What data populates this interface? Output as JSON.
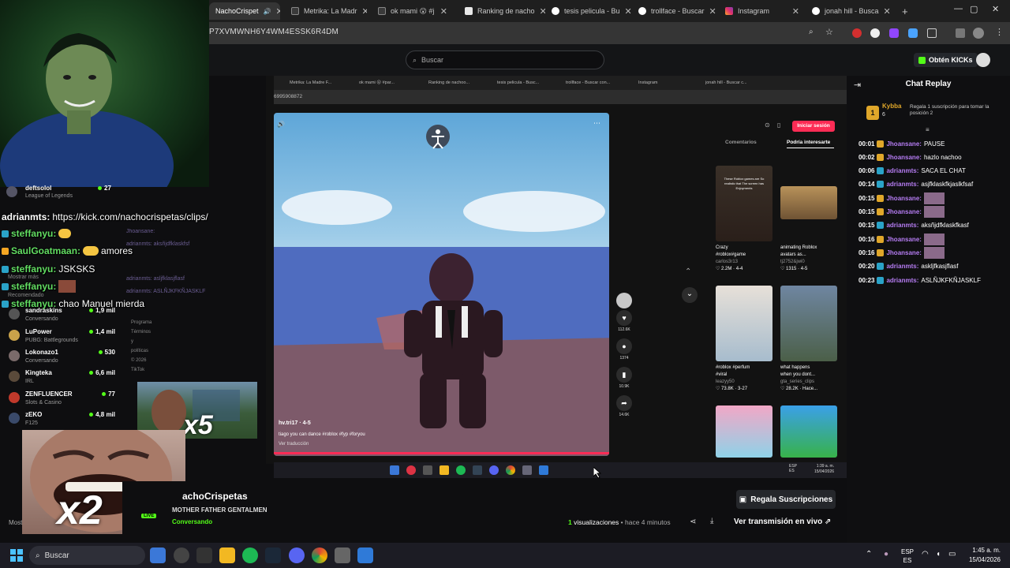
{
  "browser": {
    "tabs": [
      {
        "title": "NachoCrispet",
        "active": true
      },
      {
        "title": "Metrika: La Madr"
      },
      {
        "title": "ok mami 😮 #j"
      },
      {
        "title": "Ranking de nacho"
      },
      {
        "title": "tesis pelicula - Bu"
      },
      {
        "title": "trollface - Buscar"
      },
      {
        "title": "Instagram"
      },
      {
        "title": "jonah hill - Busca"
      }
    ],
    "new_tab": "+",
    "url": "P7XVMWNH6Y4WM4ESSK6R4DM",
    "window": {
      "minimize": "—",
      "maximize": "▢",
      "close": "✕"
    }
  },
  "kick": {
    "search_placeholder": "Buscar",
    "kicks_button": "Obtén KICKs"
  },
  "overlay_chat": [
    {
      "user": "adrianmts:",
      "text": "https://kick.com/nachocrispetas/clips/",
      "user_color": "#ffffff"
    },
    {
      "user": "steffanyu:",
      "text": "",
      "emote": true
    },
    {
      "user": "SaulGoatmaan:",
      "text": "amores",
      "emote": true
    },
    {
      "user": "steffanyu:",
      "text": "JSKSKS"
    },
    {
      "user": "steffanyu:",
      "text": "",
      "emote": true
    },
    {
      "user": "steffanyu:",
      "text": "chao Manuel mierda"
    }
  ],
  "overlay_top": {
    "name": "deftsolol",
    "category": "League of Legends",
    "viewers": "27"
  },
  "overlay_labels": {
    "show_more": "Mostrar más",
    "recommended": "Recomendado"
  },
  "faded_chat": [
    "Jhoansane:",
    "adrianmts: aksñjdfklaskfsf",
    "adrianmts: asljfklasjflasf",
    "adrianmts: ASLÑJKFKÑJASKLF"
  ],
  "sidebar": {
    "streams": [
      {
        "name": "sandraskins",
        "category": "Conversando",
        "viewers": "1,9 mil"
      },
      {
        "name": "LuPower",
        "category": "PUBG: Battlegrounds",
        "viewers": "1,4 mil"
      },
      {
        "name": "Lokonazo1",
        "category": "Conversando",
        "viewers": "530"
      },
      {
        "name": "Kingteka",
        "category": "IRL",
        "viewers": "6,6 mil"
      },
      {
        "name": "ZENFLUENCER",
        "category": "Slots & Casino",
        "viewers": "77"
      },
      {
        "name": "zEKO",
        "category": "F125",
        "viewers": "4,8 mil"
      }
    ],
    "show_more": "Mostrar más",
    "footer": [
      "Programa",
      "Términos y políticas",
      "© 2026 TikTok"
    ]
  },
  "embed": {
    "tabs": [
      "Metrika: La Madre F...",
      "ok mami 😮 #par...",
      "Ranking de nachoo...",
      "tesis pelicula - Busc...",
      "trollface - Buscar con...",
      "Instagram",
      "jonah hill - Buscar c..."
    ],
    "url": "6995908872",
    "login_button": "Iniciar sesión",
    "panel_tabs": {
      "comments": "Comentarios",
      "might_interest": "Podría interesarte"
    },
    "video": {
      "user": "hv.tri17 · 4-5",
      "caption": "tiago you can dance #roblox #fyp #foryou",
      "translate": "Ver traducción"
    },
    "rail_counts": [
      "112.6K",
      "1374",
      "10.9K",
      "14.6K"
    ],
    "recommendations": [
      {
        "title": "Crazy",
        "tags": "#roblox#game",
        "user": "carlos3r13",
        "stats": "♡ 2.2M · 4-4",
        "thumb_text": "These Roblox games are So realistic that The screen has Enjoyments"
      },
      {
        "title": "animating Roblox",
        "tags": "avatars as...",
        "user": "tj2752&jwi0",
        "stats": "♡ 1315 · 4-5",
        "thumb_text": ""
      },
      {
        "title": "#roblox #perfum",
        "tags": "#viral",
        "user": "leazyy50",
        "stats": "♡ 73.8K · 3-27",
        "thumb_text": ""
      },
      {
        "title": "what happens",
        "tags": "when you dont...",
        "user": "gta_series_clips",
        "stats": "♡ 28.2K · Hace...",
        "thumb_text": ""
      }
    ],
    "inner_taskbar": {
      "lang": "ESP\nES",
      "time": "1:39 a. m.",
      "date": "15/04/2026"
    }
  },
  "clip_overlay_text": {
    "a": "x5",
    "b": "x2"
  },
  "chat_replay": {
    "title": "Chat Replay",
    "pinned": {
      "user": "Kybba",
      "level": "6",
      "text": "Regala 1 suscripción para tomar la posición 2",
      "rank": "1"
    },
    "messages": [
      {
        "time": "00:01",
        "user": "Jhoansane:",
        "text": "PAUSE",
        "color": "#b57cf2"
      },
      {
        "time": "00:02",
        "user": "Jhoansane:",
        "text": "hazlo nachoo",
        "color": "#b57cf2"
      },
      {
        "time": "00:06",
        "user": "adrianmts:",
        "text": "SACA EL CHAT",
        "color": "#b57cf2"
      },
      {
        "time": "00:14",
        "user": "adrianmts:",
        "text": "asjfklaskfkjaslkfsaf",
        "color": "#b57cf2"
      },
      {
        "time": "00:15",
        "user": "Jhoansane:",
        "text": "",
        "color": "#b57cf2",
        "emote": true
      },
      {
        "time": "00:15",
        "user": "Jhoansane:",
        "text": "",
        "color": "#b57cf2",
        "emote": true
      },
      {
        "time": "00:15",
        "user": "adrianmts:",
        "text": "aksñjdfklaskfkasf",
        "color": "#b57cf2"
      },
      {
        "time": "00:16",
        "user": "Jhoansane:",
        "text": "",
        "color": "#b57cf2",
        "emote": true
      },
      {
        "time": "00:16",
        "user": "Jhoansane:",
        "text": "",
        "color": "#b57cf2",
        "emote": true
      },
      {
        "time": "00:20",
        "user": "adrianmts:",
        "text": "askljfkasjflasf",
        "color": "#b57cf2"
      },
      {
        "time": "00:23",
        "user": "adrianmts:",
        "text": "ASLÑJKFKÑJASKLF",
        "color": "#b57cf2"
      }
    ]
  },
  "channel": {
    "name": "NachoCrispetas",
    "display_name": "achoCrispetas",
    "stream_title": "MOTHER FATHER GENTALMEN",
    "category": "Conversando",
    "live_badge": "LIVE",
    "views_count": "1",
    "views_label": "visualizaciones",
    "ago": "hace 4 minutos",
    "gift_button": "Regala Suscripciones",
    "watch_live": "Ver transmisión en vivo"
  },
  "taskbar": {
    "search": "Buscar",
    "lang": "ESP",
    "lang2": "ES",
    "time": "1:45 a. m.",
    "date": "15/04/2026"
  },
  "colors": {
    "kick_green": "#53fc18",
    "tiktok_red": "#fe2c55",
    "chat_user": "#b57cf2"
  }
}
